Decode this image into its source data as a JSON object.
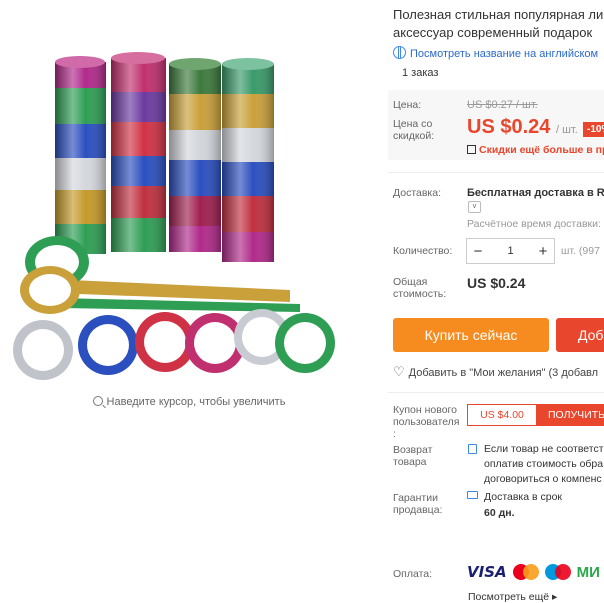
{
  "product": {
    "title_line1": "Полезная стильная популярная ли",
    "title_line2": "аксессуар современный подарок",
    "english_name_link": "Посмотреть название на английском",
    "orders": "1 заказ",
    "zoom_hint": "Наведите курсор, чтобы увеличить",
    "globe_icon": "globe-icon",
    "zoom_icon": "magnifier-icon"
  },
  "price": {
    "label": "Цена:",
    "old_value": "US $0.27 / шт.",
    "discount_label_1": "Цена со",
    "discount_label_2": "скидкой:",
    "new_value": "US $0.24",
    "unit": "/ шт.",
    "discount_badge": "-10%",
    "qr_text": "Скидки ещё больше в пр",
    "qr_icon": "qr-code-icon"
  },
  "shipping": {
    "label": "Доставка:",
    "value": "Бесплатная доставка в Ru",
    "estimate": "Расчётное время доставки:",
    "chevron_icon": "chevron-down-icon"
  },
  "quantity": {
    "label": "Количество:",
    "minus": "−",
    "value": "1",
    "plus": "+",
    "available": "шт. (997"
  },
  "total": {
    "label_1": "Общая",
    "label_2": "стоимость:",
    "value": "US $0.24"
  },
  "actions": {
    "buy_now": "Купить сейчас",
    "add_to_cart": "Доб",
    "wishlist": "Добавить в \"Мои желания\" (3 добавл",
    "wishlist_icon": "heart-icon"
  },
  "coupon": {
    "label_1": "Купон нового",
    "label_2": "пользователя",
    "label_3": ":",
    "value": "US $4.00",
    "button": "ПОЛУЧИТЬ"
  },
  "returns": {
    "label_1": "Возврат",
    "label_2": "товара",
    "text_1": "Если товар не соответст",
    "text_2": "оплатив стоимость обра",
    "text_3": "договориться о компенс",
    "icon": "document-icon"
  },
  "guarantee": {
    "label_1": "Гарантии",
    "label_2": "продавца:",
    "text_1": "Доставка в срок",
    "text_2": "60 дн.",
    "icon": "truck-icon"
  },
  "payment": {
    "label": "Оплата:",
    "visa": "VISA",
    "mastercard": "MasterCard",
    "maestro": "Maestro",
    "mir": "МИ",
    "more": "Посмотреть ещё ▸"
  },
  "colors": {
    "accent_red": "#e8462d",
    "buy_orange": "#f68b1f",
    "link_blue": "#2b6acb"
  }
}
